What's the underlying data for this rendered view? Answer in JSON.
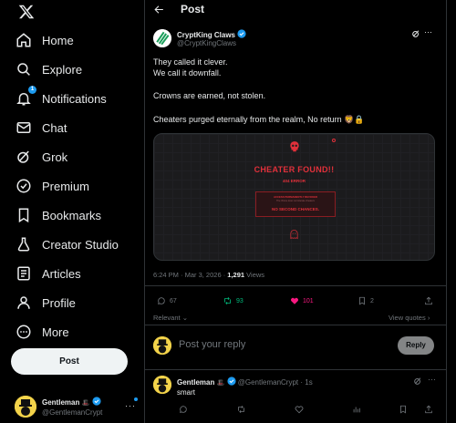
{
  "nav": {
    "items": [
      {
        "label": "Home",
        "icon": "home-icon"
      },
      {
        "label": "Explore",
        "icon": "search-icon"
      },
      {
        "label": "Notifications",
        "icon": "bell-icon",
        "badge": "1"
      },
      {
        "label": "Chat",
        "icon": "mail-icon"
      },
      {
        "label": "Grok",
        "icon": "grok-icon"
      },
      {
        "label": "Premium",
        "icon": "verified-badge-icon"
      },
      {
        "label": "Bookmarks",
        "icon": "bookmark-icon"
      },
      {
        "label": "Creator Studio",
        "icon": "creator-icon"
      },
      {
        "label": "Articles",
        "icon": "article-icon"
      },
      {
        "label": "Profile",
        "icon": "person-icon"
      },
      {
        "label": "More",
        "icon": "more-circle-icon"
      }
    ],
    "post_button": "Post",
    "account": {
      "name": "Gentleman",
      "handle": "@GentlemanCrypt",
      "emoji": "🎩"
    }
  },
  "header": {
    "title": "Post"
  },
  "post": {
    "author": "CryptKing Claws",
    "handle": "@CryptKingClaws",
    "lines": [
      "They called it clever.",
      "We call it downfall.",
      "Crowns are earned, not stolen.",
      "Cheaters purged eternally from the realm, No return 🦁🔒"
    ],
    "media": {
      "title": "CHEATER FOUND!!",
      "subtitle": "404 ERROR",
      "box_line1": "ACCESS PERMANENTLY REVOKED",
      "box_line2": "The throne does not tolerate cheaters",
      "box_line3": "NO SECOND CHANCES."
    },
    "time": "6:24 PM · Mar 3, 2026 · ",
    "views_count": "1,291",
    "views_label": " Views",
    "stats": {
      "replies": "67",
      "reposts": "93",
      "likes": "101",
      "bookmarks": "2"
    },
    "relevant": "Relevant",
    "view_quotes": "View quotes"
  },
  "reply_box": {
    "placeholder": "Post your reply",
    "button": "Reply"
  },
  "reply": {
    "author": "Gentleman",
    "emoji": "🎩",
    "handle": "@GentlemanCrypt",
    "time": "· 1s",
    "text": "smart"
  },
  "colors": {
    "accent": "#1d9bf0",
    "like": "#f91880",
    "repost": "#00ba7c",
    "error_red": "#e0303a"
  }
}
